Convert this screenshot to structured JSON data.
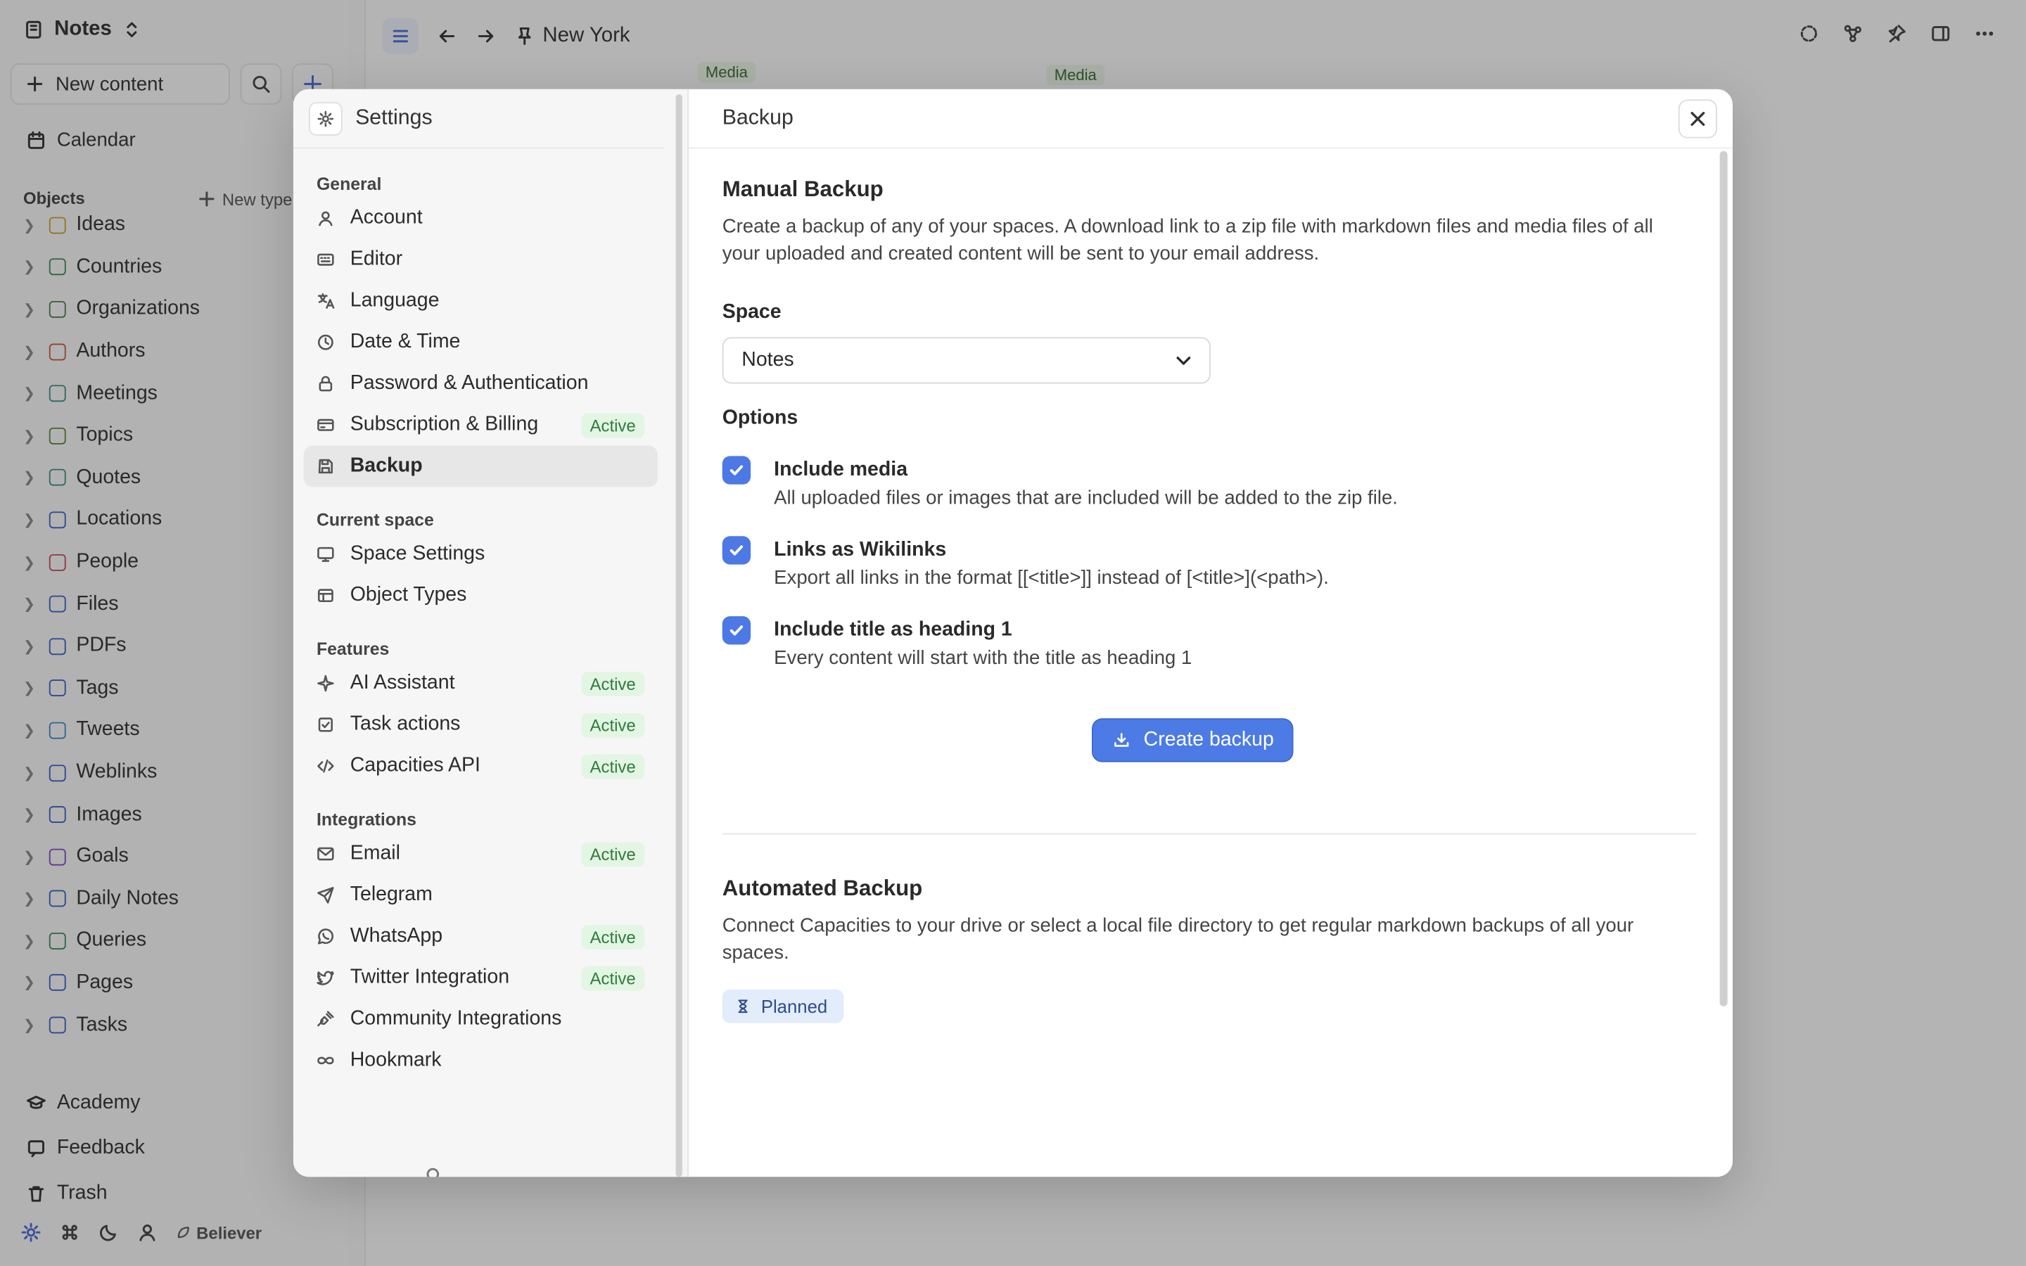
{
  "workspace": {
    "name": "Notes"
  },
  "sidebar": {
    "new_content": "New content",
    "calendar": "Calendar",
    "objects_label": "Objects",
    "new_type": "New type",
    "items": [
      {
        "label": "Ideas",
        "color": "#c9a227"
      },
      {
        "label": "Countries",
        "color": "#3a8a5c"
      },
      {
        "label": "Organizations",
        "color": "#4b7d52"
      },
      {
        "label": "Authors",
        "color": "#c85a3a"
      },
      {
        "label": "Meetings",
        "color": "#3b8f84"
      },
      {
        "label": "Topics",
        "color": "#5a8a3a"
      },
      {
        "label": "Quotes",
        "color": "#3b8f84"
      },
      {
        "label": "Locations",
        "color": "#3a5fc8"
      },
      {
        "label": "People",
        "color": "#c84a5a"
      },
      {
        "label": "Files",
        "color": "#3a5fc8"
      },
      {
        "label": "PDFs",
        "color": "#3a5fc8"
      },
      {
        "label": "Tags",
        "color": "#3a5fc8"
      },
      {
        "label": "Tweets",
        "color": "#3a8ac8"
      },
      {
        "label": "Weblinks",
        "color": "#3a5fc8"
      },
      {
        "label": "Images",
        "color": "#3a5fc8"
      },
      {
        "label": "Goals",
        "color": "#7a4ac8"
      },
      {
        "label": "Daily Notes",
        "color": "#3a5fc8"
      },
      {
        "label": "Queries",
        "color": "#3a8a5c"
      },
      {
        "label": "Pages",
        "color": "#3a5fc8"
      },
      {
        "label": "Tasks",
        "color": "#3a5fc8"
      }
    ],
    "academy": "Academy",
    "feedback": "Feedback",
    "trash": "Trash",
    "plan": "Believer"
  },
  "topbar": {
    "title": "New York",
    "media_tag": "Media"
  },
  "settings": {
    "title": "Settings",
    "sections": [
      {
        "label": "General",
        "items": [
          {
            "label": "Account",
            "icon": "user-icon",
            "badge": ""
          },
          {
            "label": "Editor",
            "icon": "keyboard-icon",
            "badge": ""
          },
          {
            "label": "Language",
            "icon": "translate-icon",
            "badge": ""
          },
          {
            "label": "Date & Time",
            "icon": "clock-icon",
            "badge": ""
          },
          {
            "label": "Password & Authentication",
            "icon": "lock-icon",
            "badge": ""
          },
          {
            "label": "Subscription & Billing",
            "icon": "credit-card-icon",
            "badge": "Active"
          },
          {
            "label": "Backup",
            "icon": "save-icon",
            "badge": "",
            "selected": true
          }
        ]
      },
      {
        "label": "Current space",
        "items": [
          {
            "label": "Space Settings",
            "icon": "monitor-icon",
            "badge": ""
          },
          {
            "label": "Object Types",
            "icon": "table-icon",
            "badge": ""
          }
        ]
      },
      {
        "label": "Features",
        "items": [
          {
            "label": "AI Assistant",
            "icon": "sparkle-icon",
            "badge": "Active"
          },
          {
            "label": "Task actions",
            "icon": "checkbox-icon",
            "badge": "Active"
          },
          {
            "label": "Capacities API",
            "icon": "code-icon",
            "badge": "Active"
          }
        ]
      },
      {
        "label": "Integrations",
        "items": [
          {
            "label": "Email",
            "icon": "mail-icon",
            "badge": "Active"
          },
          {
            "label": "Telegram",
            "icon": "send-icon",
            "badge": ""
          },
          {
            "label": "WhatsApp",
            "icon": "whatsapp-icon",
            "badge": "Active"
          },
          {
            "label": "Twitter Integration",
            "icon": "twitter-icon",
            "badge": "Active"
          },
          {
            "label": "Community Integrations",
            "icon": "plug-icon",
            "badge": ""
          },
          {
            "label": "Hookmark",
            "icon": "infinity-icon",
            "badge": ""
          }
        ]
      }
    ]
  },
  "backup": {
    "header": "Backup",
    "manual_title": "Manual Backup",
    "manual_desc": "Create a backup of any of your spaces. A download link to a zip file with markdown files and media files of all your uploaded and created content will be sent to your email address.",
    "space_label": "Space",
    "space_value": "Notes",
    "options_label": "Options",
    "options": [
      {
        "title": "Include media",
        "desc": "All uploaded files or images that are included will be added to the zip file.",
        "checked": true
      },
      {
        "title": "Links as Wikilinks",
        "desc": "Export all links in the format [[<title>]] instead of [<title>](<path>).",
        "checked": true
      },
      {
        "title": "Include title as heading 1",
        "desc": "Every content will start with the title as heading 1",
        "checked": true
      }
    ],
    "create_button": "Create backup",
    "auto_title": "Automated Backup",
    "auto_desc": "Connect Capacities to your drive or select a local file directory to get regular markdown backups of all your spaces.",
    "planned": "Planned"
  },
  "colors": {
    "accent": "#4c7be6",
    "active_badge_bg": "#e3f5e3",
    "active_badge_fg": "#2f7a3e"
  }
}
